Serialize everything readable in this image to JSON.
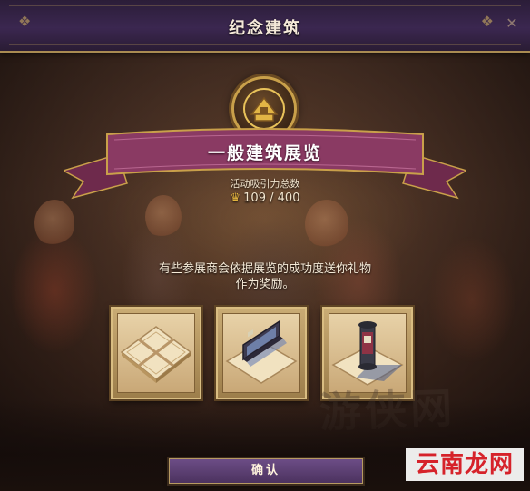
{
  "window": {
    "title": "纪念建筑",
    "close_glyph": "✕"
  },
  "event": {
    "name": "一般建筑展览",
    "attraction_label": "活动吸引力总数",
    "attraction_current": "109",
    "attraction_separator": "/",
    "attraction_max": "400",
    "attraction_icon": "trophy-icon",
    "attraction_progress": 0.2725
  },
  "description": {
    "line1": "有些参展商会依据展览的成功度送你礼物",
    "line2": "作为奖励。"
  },
  "rewards": [
    {
      "icon": "plaza-tile-icon"
    },
    {
      "icon": "billboard-wall-icon"
    },
    {
      "icon": "advertising-column-icon"
    }
  ],
  "buttons": {
    "confirm": "确认"
  },
  "watermark": {
    "faint": "游侠网",
    "site": "云南龙网"
  },
  "colors": {
    "title_bar": "#3b2750",
    "ribbon": "#8a3a63",
    "gold": "#c9a04a",
    "button": "#5c3f74",
    "site_red": "#d6222a"
  }
}
